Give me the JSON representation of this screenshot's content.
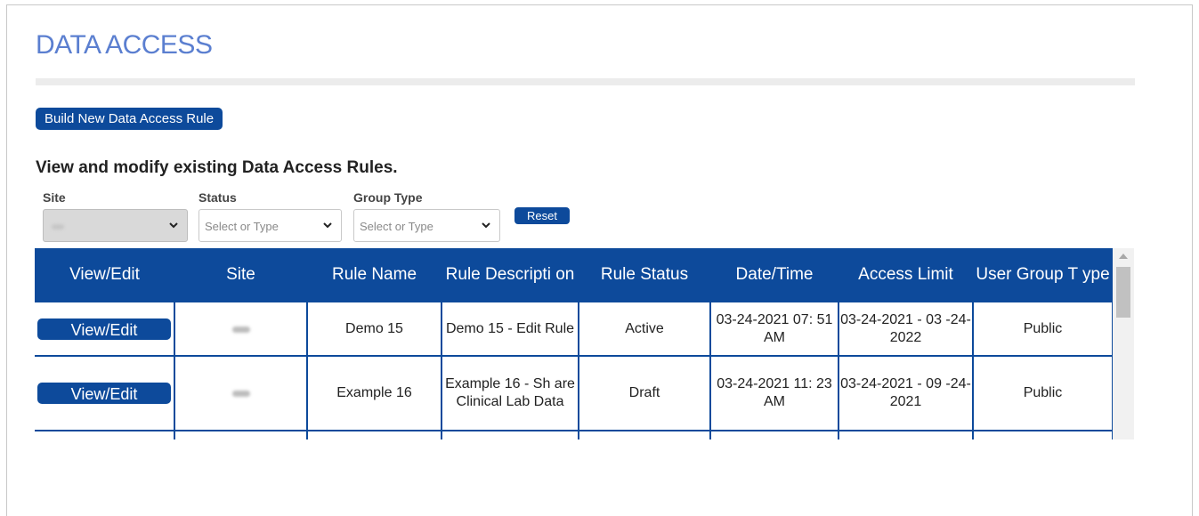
{
  "page": {
    "title": "DATA ACCESS"
  },
  "actions": {
    "build_new_label": "Build New Data Access Rule"
  },
  "section": {
    "heading": "View and modify existing Data Access Rules."
  },
  "filters": {
    "site": {
      "label": "Site",
      "value": ""
    },
    "status": {
      "label": "Status",
      "placeholder": "Select or Type"
    },
    "group_type": {
      "label": "Group Type",
      "placeholder": "Select or Type"
    },
    "reset_label": "Reset"
  },
  "table": {
    "headers": [
      "View/Edit",
      "Site",
      "Rule Name",
      "Rule Descripti on",
      "Rule Status",
      "Date/Time",
      "Access Limit",
      "User Group T ype"
    ],
    "view_edit_label": "View/Edit",
    "rows": [
      {
        "site": "",
        "rule_name": "Demo 15",
        "rule_description": "Demo 15 - Edit Rule",
        "rule_status": "Active",
        "date_time": "03-24-2021 07: 51 AM",
        "access_limit": "03-24-2021 - 03 -24-2022",
        "user_group_type": "Public"
      },
      {
        "site": "",
        "rule_name": "Example 16",
        "rule_description": "Example 16 - Sh are Clinical Lab Data",
        "rule_status": "Draft",
        "date_time": "03-24-2021 11: 23 AM",
        "access_limit": "03-24-2021 - 09 -24-2021",
        "user_group_type": "Public"
      }
    ]
  },
  "colors": {
    "primary": "#0d4a9b",
    "title": "#5b7fd0"
  },
  "icons": {
    "dropdown": "chevron-down-icon",
    "scroll_up": "scroll-up-arrow-icon"
  }
}
